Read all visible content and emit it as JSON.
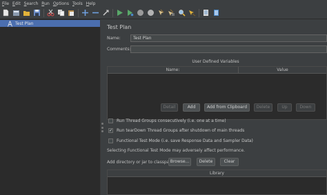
{
  "menubar": {
    "items": [
      "File",
      "Edit",
      "Search",
      "Run",
      "Options",
      "Tools",
      "Help"
    ]
  },
  "toolbar": {
    "icons": [
      "new-icon",
      "templates-icon",
      "open-icon",
      "save-icon",
      "cut-icon",
      "copy-icon",
      "paste-icon",
      "expand-icon",
      "collapse-icon",
      "toggle-icon",
      "start-icon",
      "start-no-pauses-icon",
      "stop-icon",
      "shutdown-icon",
      "clear-icon",
      "clear-all-icon",
      "search-icon",
      "reset-search-icon",
      "function-helper-icon",
      "help-icon"
    ]
  },
  "tree": {
    "items": [
      {
        "label": "Test Plan",
        "selected": true
      }
    ]
  },
  "test_plan": {
    "title": "Test Plan",
    "name_label": "Name:",
    "name_value": "Test Plan",
    "comments_label": "Comments:",
    "comments_value": "",
    "udv_title": "User Defined Variables",
    "udv_columns": [
      "Name:",
      "Value"
    ],
    "udv_rows": [],
    "buttons": {
      "detail": "Detail",
      "add": "Add",
      "add_from_clipboard": "Add from Clipboard",
      "delete": "Delete",
      "up": "Up",
      "down": "Down"
    },
    "options": [
      {
        "label": "Run Thread Groups consecutively (i.e. one at a time)",
        "checked": false
      },
      {
        "label": "Run tearDown Thread Groups after shutdown of main threads",
        "checked": true
      },
      {
        "label": "Functional Test Mode (i.e. save Response Data and Sampler Data)",
        "checked": false
      }
    ],
    "functional_note": "Selecting Functional Test Mode may adversely affect performance.",
    "classpath_label": "Add directory or jar to classpath",
    "classpath_buttons": {
      "browse": "Browse...",
      "delete": "Delete",
      "clear": "Clear"
    },
    "library_column": "Library",
    "library_rows": []
  },
  "colors": {
    "background": "#3c3f41",
    "selection": "#4b6eaf",
    "start_green": "#59a869",
    "stop_gray": "#9a9a9a"
  }
}
